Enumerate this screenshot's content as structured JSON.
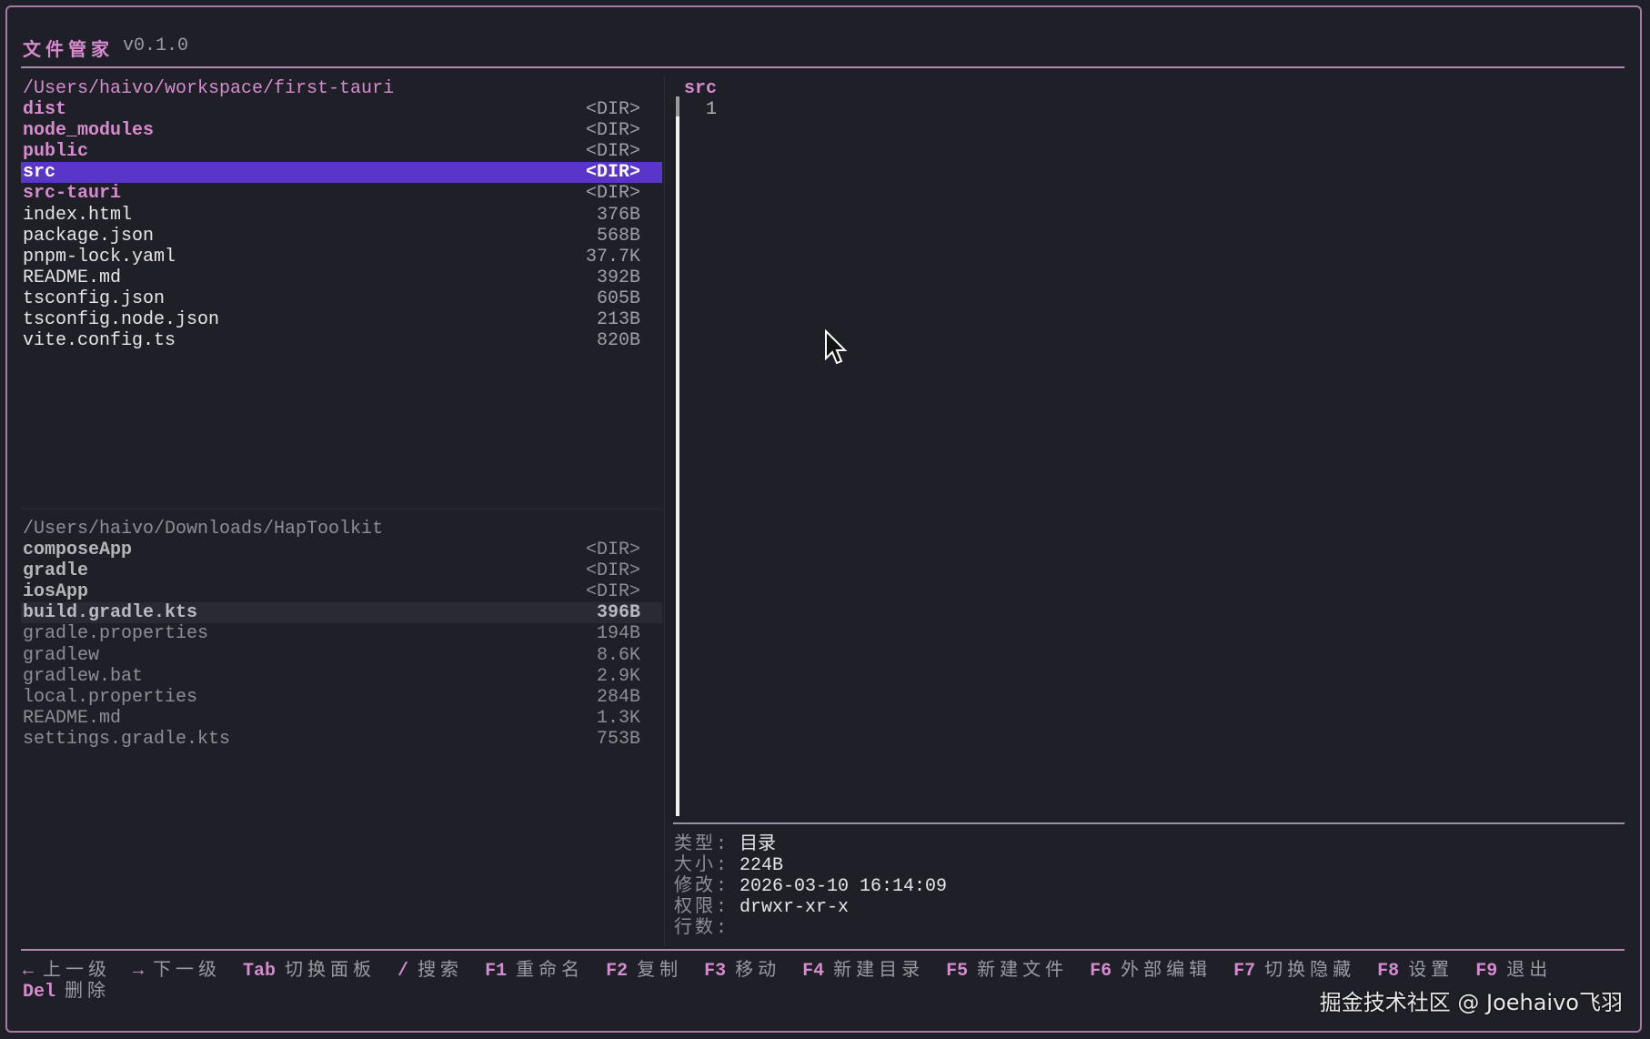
{
  "app": {
    "title": "文件管家",
    "version": "v0.1.0"
  },
  "left_pane": {
    "path": "/Users/haivo/workspace/first-tauri",
    "entries": [
      {
        "name": "dist",
        "size": "<DIR>"
      },
      {
        "name": "node_modules",
        "size": "<DIR>"
      },
      {
        "name": "public",
        "size": "<DIR>"
      },
      {
        "name": "src",
        "size": "<DIR>"
      },
      {
        "name": "src-tauri",
        "size": "<DIR>"
      },
      {
        "name": "index.html",
        "size": "376B"
      },
      {
        "name": "package.json",
        "size": "568B"
      },
      {
        "name": "pnpm-lock.yaml",
        "size": "37.7K"
      },
      {
        "name": "README.md",
        "size": "392B"
      },
      {
        "name": "tsconfig.json",
        "size": "605B"
      },
      {
        "name": "tsconfig.node.json",
        "size": "213B"
      },
      {
        "name": "vite.config.ts",
        "size": "820B"
      }
    ]
  },
  "right_pane": {
    "path": "/Users/haivo/Downloads/HapToolkit",
    "entries": [
      {
        "name": "composeApp",
        "size": "<DIR>"
      },
      {
        "name": "gradle",
        "size": "<DIR>"
      },
      {
        "name": "iosApp",
        "size": "<DIR>"
      },
      {
        "name": "build.gradle.kts",
        "size": "396B"
      },
      {
        "name": "gradle.properties",
        "size": "194B"
      },
      {
        "name": "gradlew",
        "size": "8.6K"
      },
      {
        "name": "gradlew.bat",
        "size": "2.9K"
      },
      {
        "name": "local.properties",
        "size": "284B"
      },
      {
        "name": "README.md",
        "size": "1.3K"
      },
      {
        "name": "settings.gradle.kts",
        "size": "753B"
      }
    ]
  },
  "preview": {
    "title": "src",
    "line_number": "1"
  },
  "info": [
    {
      "label": "类型:",
      "value": "目录"
    },
    {
      "label": "大小:",
      "value": "224B"
    },
    {
      "label": "修改:",
      "value": "2026-03-10 16:14:09"
    },
    {
      "label": "权限:",
      "value": "drwxr-xr-x"
    },
    {
      "label": "行数:",
      "value": ""
    }
  ],
  "help": [
    {
      "key": "←",
      "label": "上一级"
    },
    {
      "key": "→",
      "label": "下一级"
    },
    {
      "key": "Tab",
      "label": "切换面板"
    },
    {
      "key": "/",
      "label": "搜索"
    },
    {
      "key": "F1",
      "label": "重命名"
    },
    {
      "key": "F2",
      "label": "复制"
    },
    {
      "key": "F3",
      "label": "移动"
    },
    {
      "key": "F4",
      "label": "新建目录"
    },
    {
      "key": "F5",
      "label": "新建文件"
    },
    {
      "key": "F6",
      "label": "外部编辑"
    },
    {
      "key": "F7",
      "label": "切换隐藏"
    },
    {
      "key": "F8",
      "label": "设置"
    },
    {
      "key": "F9",
      "label": "退出"
    },
    {
      "key": "Del",
      "label": "删除"
    }
  ],
  "watermark": "掘金技术社区 @ Joehaivo飞羽",
  "colors": {
    "accent": "#d58ccf",
    "selection": "#5a35c9",
    "background": "#1f1f27",
    "border": "#a77aa6"
  }
}
